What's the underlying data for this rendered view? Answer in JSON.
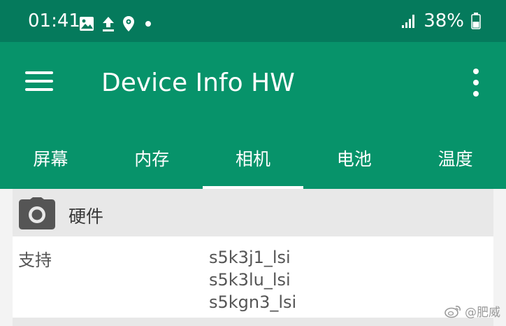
{
  "status_bar": {
    "time": "01:41",
    "battery_text": "38%",
    "left_icons": [
      "image-icon",
      "upload-icon",
      "location-icon",
      "dot-icon"
    ],
    "right_icons": [
      "signal-icon",
      "battery-icon"
    ]
  },
  "app_bar": {
    "title": "Device Info HW",
    "background": "#07936a",
    "status_background": "#057a5c"
  },
  "tabs": [
    {
      "label": "屏幕",
      "active": false
    },
    {
      "label": "内存",
      "active": false
    },
    {
      "label": "相机",
      "active": true
    },
    {
      "label": "电池",
      "active": false
    },
    {
      "label": "温度",
      "active": false
    }
  ],
  "section": {
    "icon": "camera-icon",
    "title": "硬件"
  },
  "rows": [
    {
      "label": "支持",
      "values": [
        "s5k3j1_lsi",
        "s5k3lu_lsi",
        "s5kgn3_lsi"
      ]
    }
  ],
  "watermark": {
    "icon": "weibo-icon",
    "text": "@肥威"
  }
}
